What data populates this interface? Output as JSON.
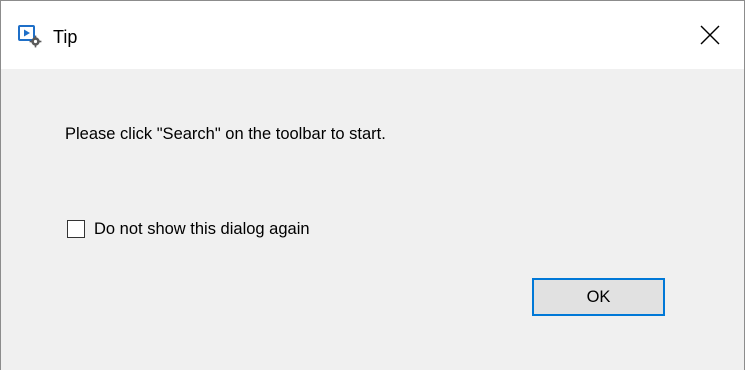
{
  "window": {
    "title": "Tip",
    "close_icon": "close-icon",
    "app_icon": "media-player-gear-icon"
  },
  "message": "Please click \"Search\" on the toolbar to start.",
  "checkbox": {
    "label": "Do not show this dialog again",
    "checked": false
  },
  "buttons": {
    "ok_label": "OK"
  },
  "colors": {
    "dialog_background": "#f0f0f0",
    "titlebar_background": "#ffffff",
    "button_focus_border": "#0078d7",
    "button_face": "#e1e1e1"
  }
}
